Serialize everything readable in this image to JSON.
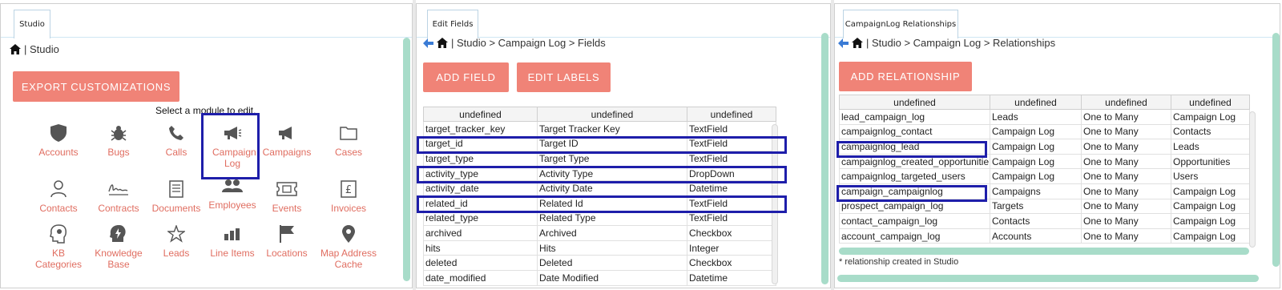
{
  "studio_panel": {
    "tab_label": "Studio",
    "breadcrumb": "| Studio",
    "export_button": "EXPORT CUSTOMIZATIONS",
    "instruction": "Select a module to edit.",
    "modules": [
      {
        "label": "Accounts",
        "icon": "shield-icon"
      },
      {
        "label": "Bugs",
        "icon": "bug-icon"
      },
      {
        "label": "Calls",
        "icon": "phone-icon"
      },
      {
        "label": "Campaign Log",
        "icon": "megaphone-icon"
      },
      {
        "label": "Campaigns",
        "icon": "megaphone-icon"
      },
      {
        "label": "Cases",
        "icon": "folder-icon"
      },
      {
        "label": "Contacts",
        "icon": "person-icon"
      },
      {
        "label": "Contracts",
        "icon": "signature-icon"
      },
      {
        "label": "Documents",
        "icon": "document-icon"
      },
      {
        "label": "Employees",
        "icon": "people-icon"
      },
      {
        "label": "Events",
        "icon": "ticket-icon"
      },
      {
        "label": "Invoices",
        "icon": "pound-icon"
      },
      {
        "label": "KB Categories",
        "icon": "head-icon"
      },
      {
        "label": "Knowledge Base",
        "icon": "lightning-icon"
      },
      {
        "label": "Leads",
        "icon": "star-icon"
      },
      {
        "label": "Line Items",
        "icon": "bars-icon"
      },
      {
        "label": "Locations",
        "icon": "flag-icon"
      },
      {
        "label": "Map Address Cache",
        "icon": "map-pin-icon"
      }
    ]
  },
  "fields_panel": {
    "tab_label": "Edit Fields",
    "breadcrumb": "| Studio > Campaign Log > Fields",
    "add_field_button": "ADD FIELD",
    "edit_labels_button": "EDIT LABELS",
    "columns": [
      "undefined",
      "undefined",
      "undefined"
    ],
    "rows": [
      [
        "target_tracker_key",
        "Target Tracker Key",
        "TextField"
      ],
      [
        "target_id",
        "Target ID",
        "TextField"
      ],
      [
        "target_type",
        "Target Type",
        "TextField"
      ],
      [
        "activity_type",
        "Activity Type",
        "DropDown"
      ],
      [
        "activity_date",
        "Activity Date",
        "Datetime"
      ],
      [
        "related_id",
        "Related Id",
        "TextField"
      ],
      [
        "related_type",
        "Related Type",
        "TextField"
      ],
      [
        "archived",
        "Archived",
        "Checkbox"
      ],
      [
        "hits",
        "Hits",
        "Integer"
      ],
      [
        "deleted",
        "Deleted",
        "Checkbox"
      ],
      [
        "date_modified",
        "Date Modified",
        "Datetime"
      ]
    ]
  },
  "relationships_panel": {
    "tab_label": "CampaignLog Relationships",
    "breadcrumb": "| Studio > Campaign Log > Relationships",
    "add_relationship_button": "ADD RELATIONSHIP",
    "columns": [
      "undefined",
      "undefined",
      "undefined",
      "undefined"
    ],
    "rows": [
      [
        "lead_campaign_log",
        "Leads",
        "One to Many",
        "Campaign Log"
      ],
      [
        "campaignlog_contact",
        "Campaign Log",
        "One to Many",
        "Contacts"
      ],
      [
        "campaignlog_lead",
        "Campaign Log",
        "One to Many",
        "Leads"
      ],
      [
        "campaignlog_created_opportunitie",
        "Campaign Log",
        "One to Many",
        "Opportunities"
      ],
      [
        "campaignlog_targeted_users",
        "Campaign Log",
        "One to Many",
        "Users"
      ],
      [
        "campaign_campaignlog",
        "Campaigns",
        "One to Many",
        "Campaign Log"
      ],
      [
        "prospect_campaign_log",
        "Targets",
        "One to Many",
        "Campaign Log"
      ],
      [
        "contact_campaign_log",
        "Contacts",
        "One to Many",
        "Campaign Log"
      ],
      [
        "account_campaign_log",
        "Accounts",
        "One to Many",
        "Campaign Log"
      ]
    ],
    "footnote": "* relationship created in Studio"
  },
  "colors": {
    "accent": "#f08377",
    "module_text": "#e06d60",
    "highlight": "#1e1eaa",
    "scrollbar": "#a8dcc9"
  }
}
